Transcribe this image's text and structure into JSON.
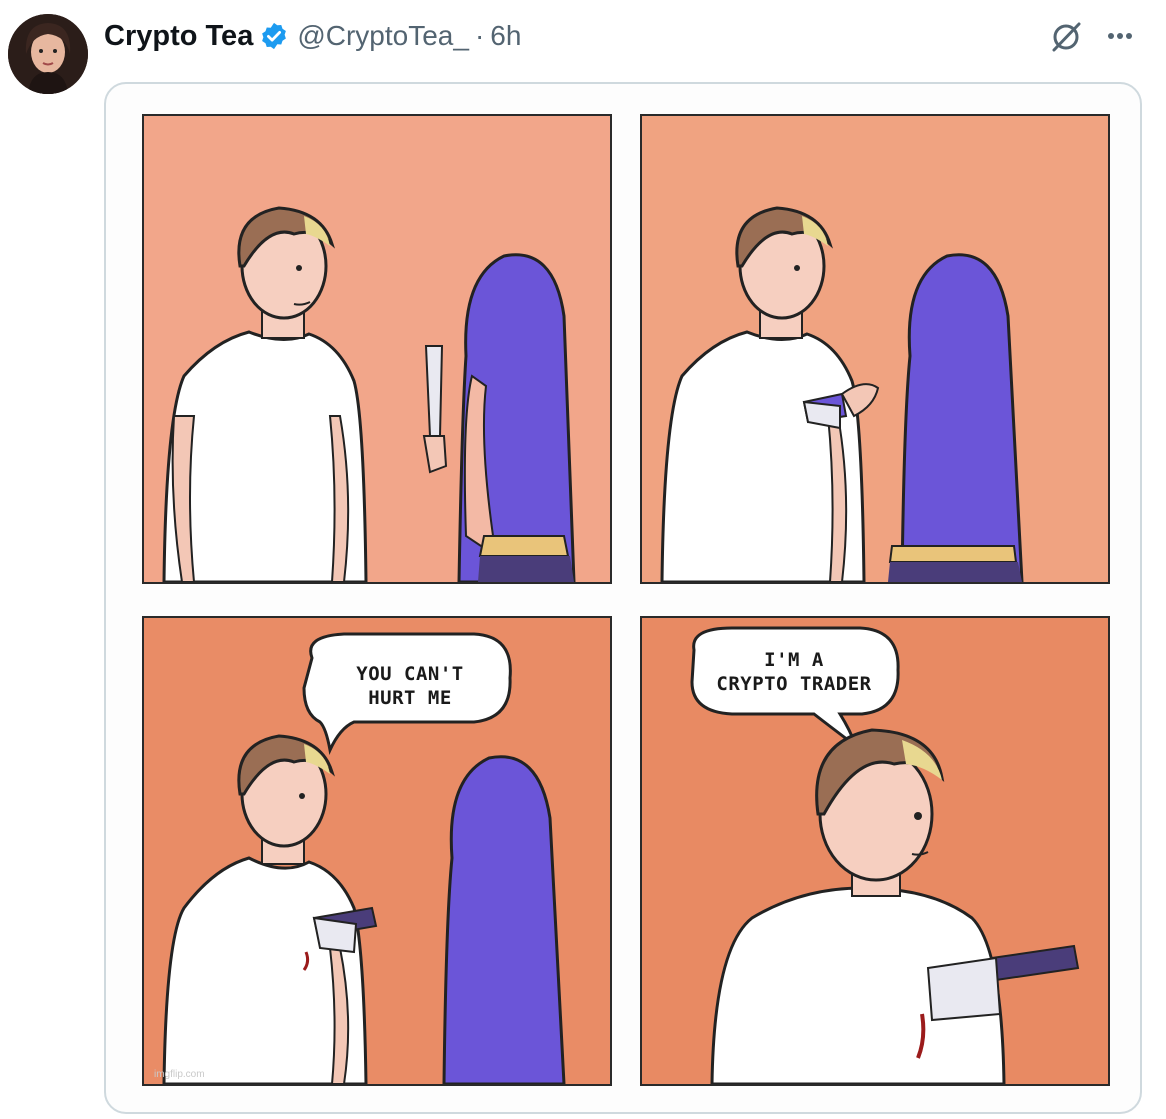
{
  "tweet": {
    "display_name": "Crypto Tea",
    "handle": "@CryptoTea_",
    "separator": "·",
    "time": "6h",
    "verified": true,
    "icons": {
      "verified": "verified-badge-icon",
      "grok": "slashed-circle-icon",
      "more": "more-dots-icon"
    }
  },
  "comic": {
    "panel3_bubble": [
      "YOU CAN'T",
      "HURT ME"
    ],
    "panel4_bubble": [
      "I'M A",
      "CRYPTO TRADER"
    ],
    "watermark": "imgflip.com"
  },
  "colors": {
    "verified_blue": "#1d9bf0",
    "muted_text": "#536471",
    "panel_bg": "#f2a68a",
    "hair_purple": "#6b55d8"
  }
}
